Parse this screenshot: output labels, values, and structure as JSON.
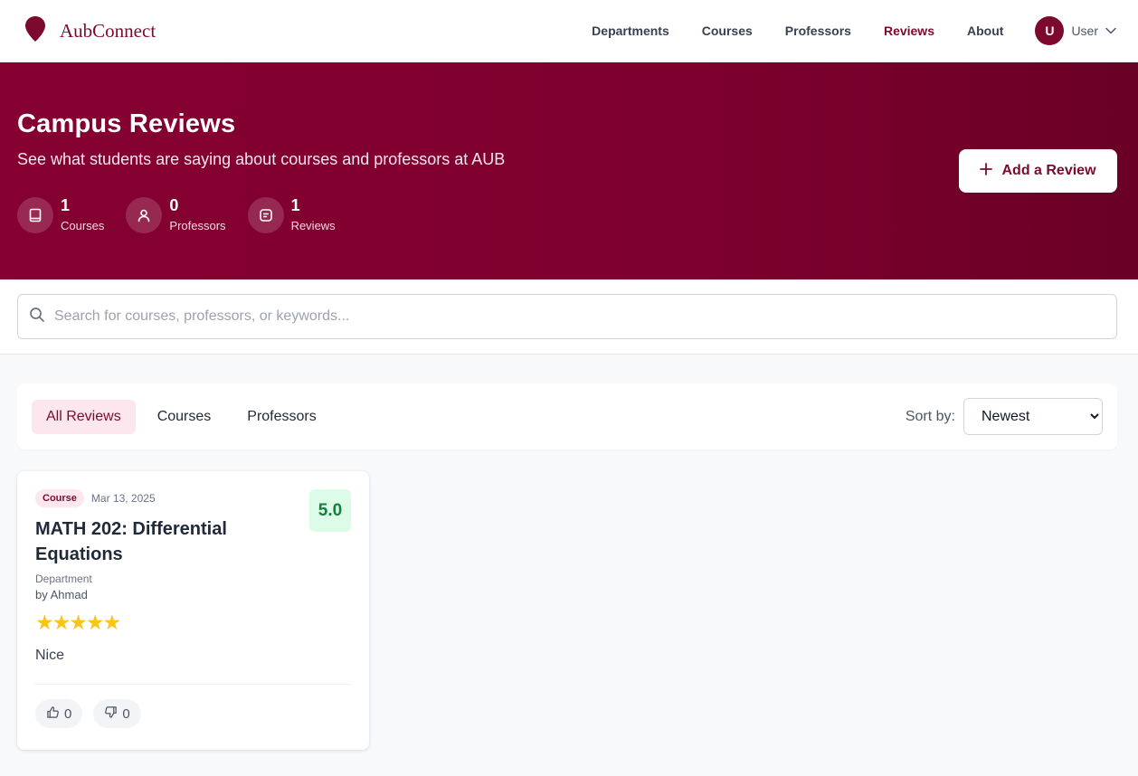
{
  "brand": {
    "name": "AubConnect",
    "icon": "map-pin-icon"
  },
  "nav": {
    "links": [
      {
        "label": "Departments"
      },
      {
        "label": "Courses"
      },
      {
        "label": "Professors"
      },
      {
        "label": "Reviews"
      },
      {
        "label": "About"
      }
    ],
    "active": "Reviews",
    "user": {
      "initial": "U",
      "name": "User"
    }
  },
  "hero": {
    "title": "Campus Reviews",
    "subtitle": "See what students are saying about courses and professors at AUB",
    "stats": [
      {
        "value": "1",
        "label": "Courses",
        "icon": "book-icon"
      },
      {
        "value": "0",
        "label": "Professors",
        "icon": "user-icon"
      },
      {
        "value": "1",
        "label": "Reviews",
        "icon": "message-icon"
      }
    ],
    "add_button": "Add a Review"
  },
  "search": {
    "placeholder": "Search for courses, professors, or keywords..."
  },
  "filters": {
    "tabs": [
      {
        "label": "All Reviews"
      },
      {
        "label": "Courses"
      },
      {
        "label": "Professors"
      }
    ],
    "active_tab": "All Reviews",
    "sort_label": "Sort by:",
    "sort_selected": "Newest"
  },
  "reviews": [
    {
      "type": "Course",
      "date": "Mar 13, 2025",
      "score": "5.0",
      "title": "MATH 202: Differential Equations",
      "department": "Department",
      "author": "by Ahmad",
      "rating": 5,
      "stars": "★★★★★",
      "comment": "Nice",
      "likes": "0",
      "dislikes": "0"
    }
  ],
  "colors": {
    "brand": "#7d0a2e",
    "score_bg": "#dcfce7",
    "score_text": "#15803d",
    "star": "#fcc419"
  }
}
